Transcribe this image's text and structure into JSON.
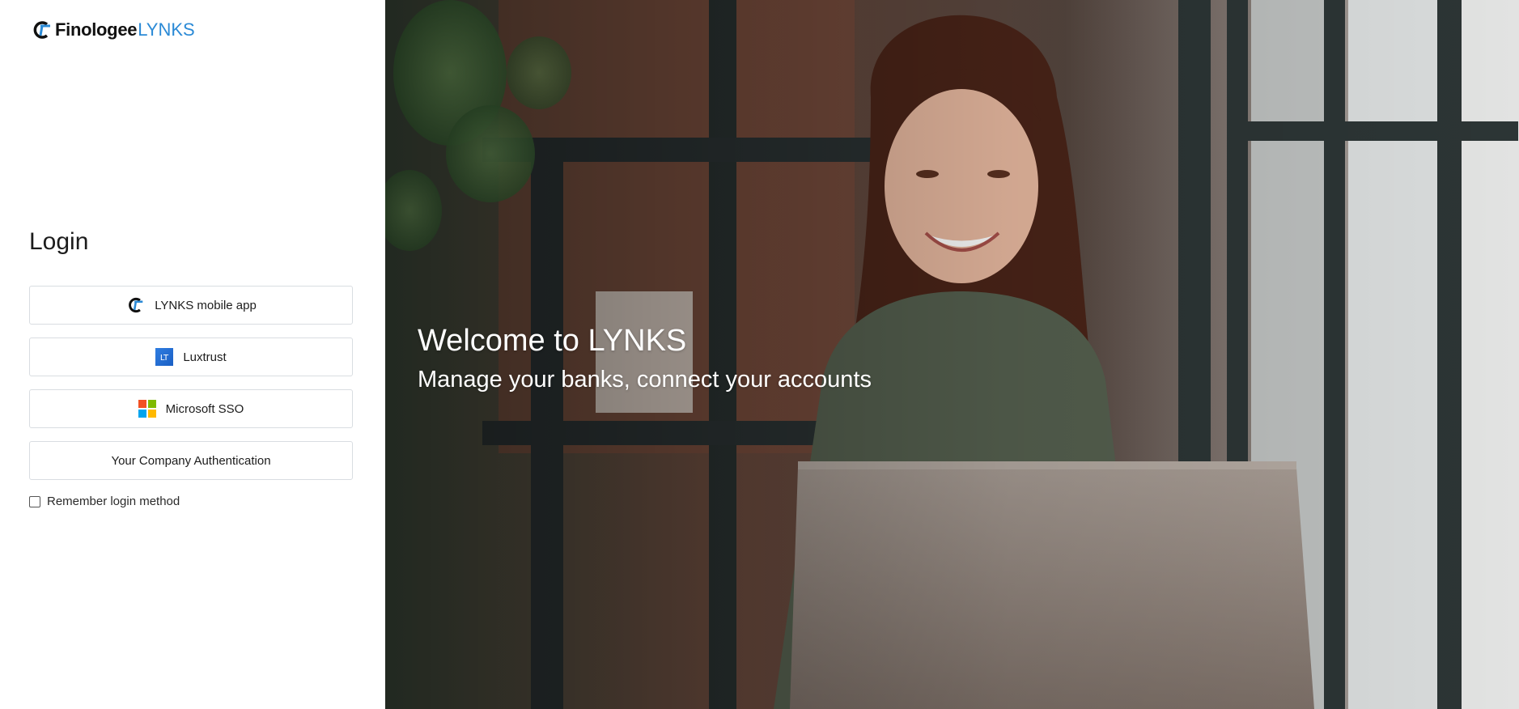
{
  "brand": {
    "name": "Finologee",
    "suffix": "LYNKS",
    "accent_color": "#2b8ad6"
  },
  "login": {
    "title": "Login",
    "methods": [
      {
        "label": "LYNKS mobile app",
        "icon": "finologee-logo-icon"
      },
      {
        "label": "Luxtrust",
        "icon": "luxtrust-icon",
        "icon_text": "LT"
      },
      {
        "label": "Microsoft SSO",
        "icon": "microsoft-icon"
      },
      {
        "label": "Your Company Authentication",
        "icon": ""
      }
    ],
    "remember_label": "Remember login method",
    "remember_checked": false
  },
  "hero": {
    "title": "Welcome to LYNKS",
    "subtitle": "Manage your banks, connect your accounts",
    "image": "woman-using-laptop-photo"
  }
}
